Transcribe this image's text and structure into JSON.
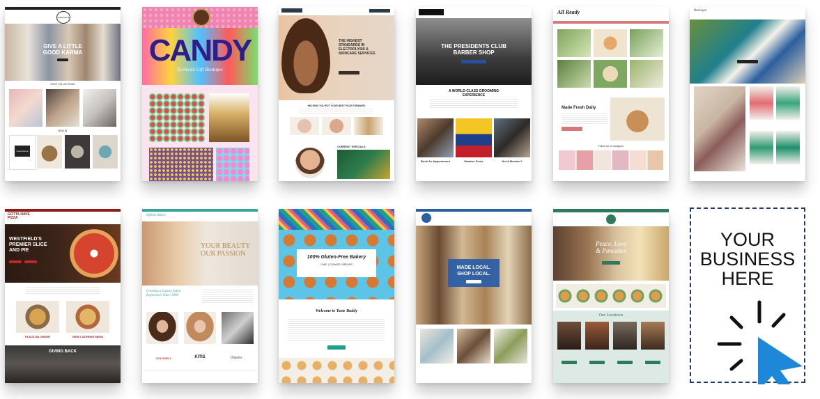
{
  "cards": [
    {
      "name": "sweet-karma",
      "headline": "GIVE A LITTLE\nGOOD KARMA",
      "section_title": "SHOP COLLECTIONS",
      "section_title_2": "NEW IN",
      "badge": "Good Karma"
    },
    {
      "name": "candy-shop",
      "headline": "CANDY",
      "sub": "Ecclectic Gift Boutique"
    },
    {
      "name": "electrolysis",
      "headline": "THE HIGHEST\nSTANDARDS IN\nELECTROLYSIS &\nSKINCARE SERVICES",
      "section_title": "HELPING YOU PUT YOUR BEST FACE FORWARD",
      "section_title_2": "CURRENT SPECIALS"
    },
    {
      "name": "presidents-club",
      "headline": "THE PRESIDENTS CLUB\nBARBER SHOP",
      "section_title": "A WORLD-CLASS GROOMING\nEXPERIENCE",
      "col1": "Book An Appointment",
      "col2": "Member Perks",
      "col3": "Not A Member?"
    },
    {
      "name": "all-ready",
      "logo": "All Ready",
      "section_title": "Made Fresh Daily",
      "section_title_2": "Follow Us on Instagram"
    },
    {
      "name": "boutique-fashion",
      "logo": "Boutique"
    },
    {
      "name": "gotta-have-pizza",
      "logo": "GOTTA HAVE\nPIZZA",
      "headline": "WESTFIELD'S\nPREMIER SLICE\nAND PIE",
      "cap1": "PLACE AN ORDER",
      "cap2": "VIEW CATERING MENU",
      "section_title": "GIVING BACK"
    },
    {
      "name": "luxury-salon",
      "logo": "Infinite Salon",
      "headline": "YOUR BEAUTY\nOUR PASSION",
      "section_title": "Creating a Luxury Salon\nExperience Since 1998",
      "brand1": "GOLDWELL",
      "brand2": "KITIS",
      "brand3": "Olaplex"
    },
    {
      "name": "gluten-free-bakery",
      "headline": "100% Gluten-Free Bakery",
      "sub": "CAKE | COOKIES | BREADS",
      "section_title": "Welcome to Taste Buddy"
    },
    {
      "name": "made-local",
      "headline": "MADE LOCAL.\nSHOP LOCAL."
    },
    {
      "name": "peace-love-pancakes",
      "headline": "Peace, Love\n& Pancakes",
      "section_title": "Our Locations"
    }
  ],
  "cta": {
    "text": "YOUR\nBUSINESS\nHERE",
    "icon": "cursor-click-icon"
  }
}
